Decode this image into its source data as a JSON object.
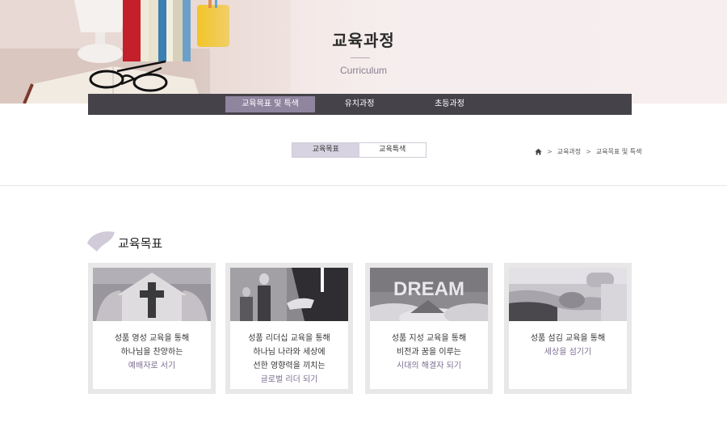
{
  "hero": {
    "title": "교육과정",
    "subtitle": "Curriculum"
  },
  "nav": {
    "items": [
      {
        "label": "교육목표 및 특색",
        "active": true
      },
      {
        "label": "유치과정",
        "active": false
      },
      {
        "label": "초등과정",
        "active": false
      }
    ]
  },
  "sub_tabs": {
    "items": [
      {
        "label": "교육목표",
        "active": true
      },
      {
        "label": "교육특색",
        "active": false
      }
    ]
  },
  "breadcrumb": {
    "icon": "home-icon",
    "items": [
      "교육과정",
      "교육목표 및 특색"
    ],
    "separator": ">"
  },
  "section": {
    "title": "교육목표"
  },
  "cards": [
    {
      "image": "cross-house-hands",
      "lines": [
        "성품 영성 교육을 통해",
        "하나님을 찬양하는"
      ],
      "highlight": "예배자로 서기"
    },
    {
      "image": "handshake-business",
      "lines": [
        "성품 리더십 교육을 통해",
        "하나님 나라와 세상에",
        "선한 영향력을 끼치는"
      ],
      "highlight": "글로벌 리더 되기"
    },
    {
      "image": "dream-clouds",
      "image_text": "DREAM",
      "lines": [
        "성품 지성 교육을 통해",
        "비전과 꿈을 이루는"
      ],
      "highlight": "시대의 해결자 되기"
    },
    {
      "image": "holding-hands",
      "lines": [
        "성품 섬김 교육을 통해"
      ],
      "highlight": "세상을 섬기기"
    }
  ],
  "colors": {
    "nav_bg": "#454349",
    "nav_active": "#8f859f",
    "tab_active": "#d7d3e1",
    "accent_text": "#7c6e92"
  }
}
